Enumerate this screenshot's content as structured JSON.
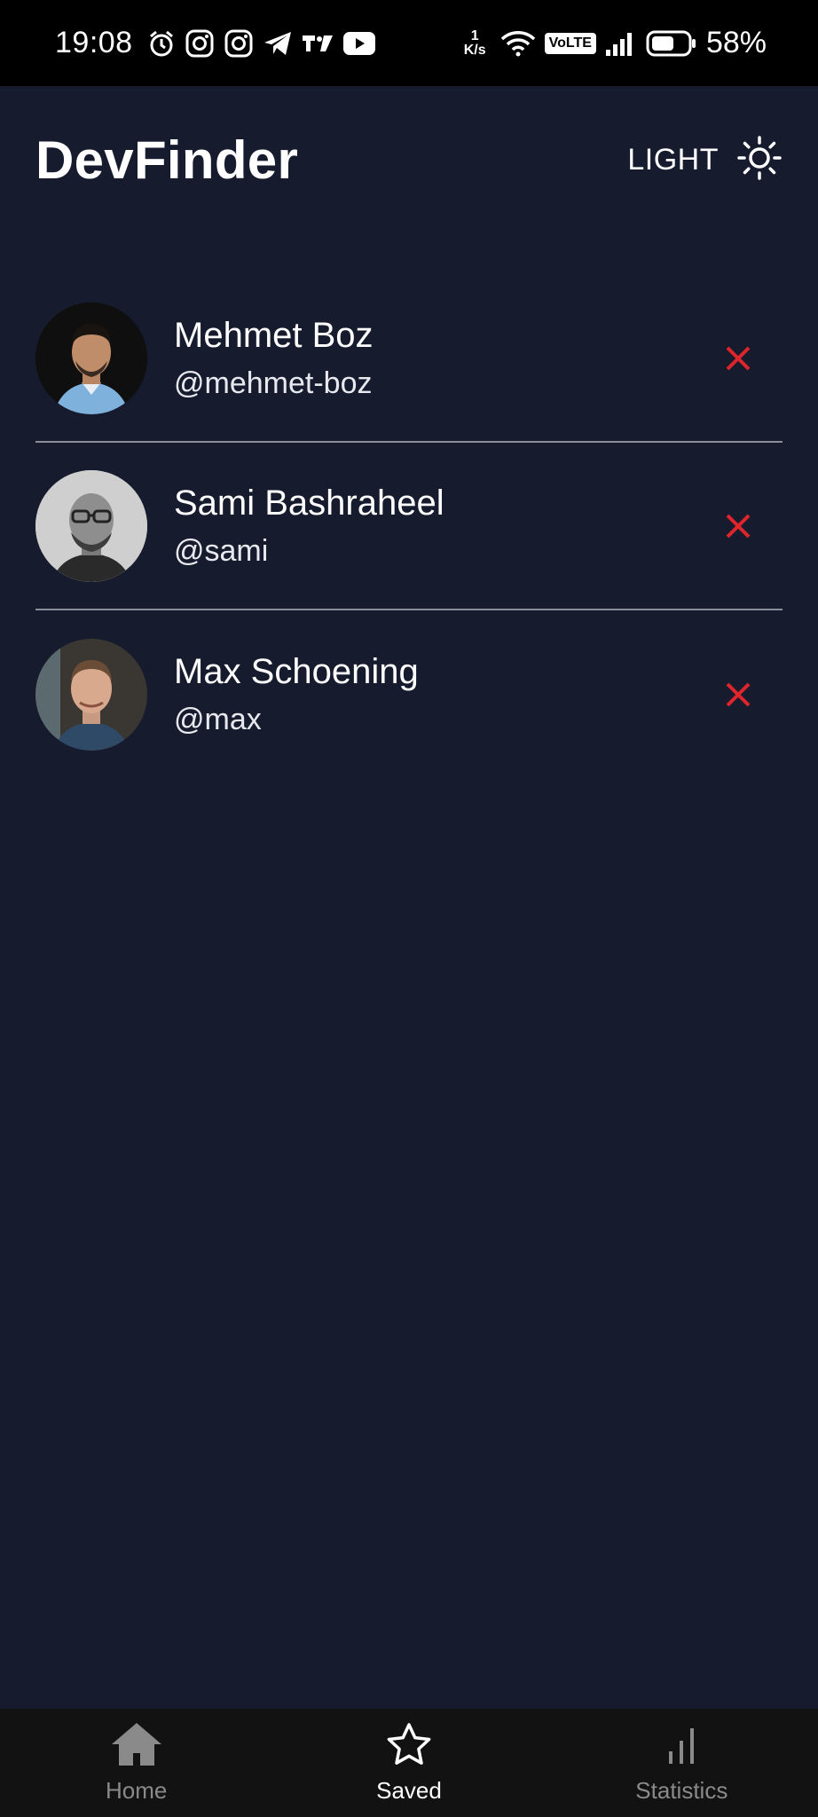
{
  "status_bar": {
    "time": "19:08",
    "net_speed_value": "1",
    "net_speed_unit": "K/s",
    "volte": "VoLTE",
    "battery_percent": "58%"
  },
  "header": {
    "title": "DevFinder",
    "theme_label": "LIGHT"
  },
  "saved_users": [
    {
      "name": "Mehmet Boz",
      "handle": "@mehmet-boz"
    },
    {
      "name": "Sami Bashraheel",
      "handle": "@sami"
    },
    {
      "name": "Max Schoening",
      "handle": "@max"
    }
  ],
  "bottom_nav": {
    "items": [
      {
        "label": "Home",
        "icon": "home-icon",
        "active": false
      },
      {
        "label": "Saved",
        "icon": "star-icon",
        "active": true
      },
      {
        "label": "Statistics",
        "icon": "bar-chart-icon",
        "active": false
      }
    ]
  },
  "colors": {
    "background": "#161b2e",
    "status_bar": "#000000",
    "bottom_nav": "#121212",
    "remove": "#e0242b",
    "divider": "#8a8e99"
  }
}
